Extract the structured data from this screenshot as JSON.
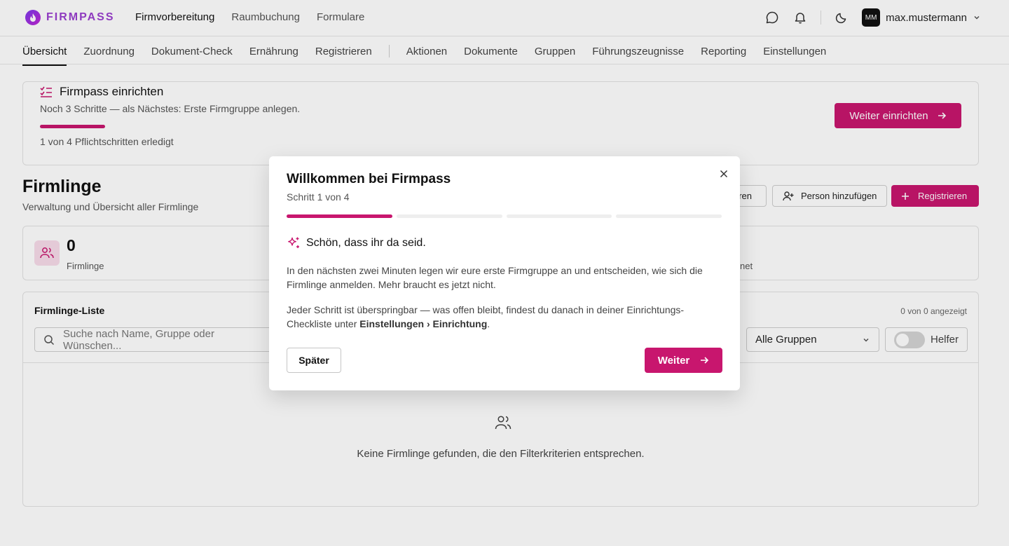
{
  "brand": {
    "name": "FIRMPASS",
    "accent": "#c8166e"
  },
  "topnav": {
    "items": [
      "Firmvorbereitung",
      "Raumbuchung",
      "Formulare"
    ],
    "user": {
      "initials": "MM",
      "name": "max.mustermann"
    }
  },
  "subnav": {
    "group1": [
      "Übersicht",
      "Zuordnung",
      "Dokument-Check",
      "Ernährung",
      "Registrieren"
    ],
    "group2": [
      "Aktionen",
      "Dokumente",
      "Gruppen",
      "Führungszeugnisse",
      "Reporting",
      "Einstellungen"
    ]
  },
  "setup": {
    "title": "Firmpass einrichten",
    "subtitle": "Noch 3 Schritte — als Nächstes: Erste Firmgruppe anlegen.",
    "count": "1 von 4 Pflichtschritten erledigt",
    "progress": 0.25,
    "button": "Weiter einrichten"
  },
  "section": {
    "title": "Firmlinge",
    "subtitle": "Verwaltung und Übersicht aller Firmlinge",
    "btn_partial": "eren",
    "btn_add": "Person hinzufügen",
    "btn_register": "Registrieren"
  },
  "stats": {
    "count": "0",
    "label": "Firmlinge",
    "right_label_partial": "net"
  },
  "list": {
    "title": "Firmlinge-Liste",
    "count": "0 von 0 angezeigt",
    "search_placeholder": "Suche nach Name, Gruppe oder Wünschen...",
    "group_select": "Alle Gruppen",
    "toggle_label": "Helfer",
    "empty": "Keine Firmlinge gefunden, die den Filterkriterien entsprechen."
  },
  "modal": {
    "title": "Willkommen bei Firmpass",
    "step": "Schritt 1 von 4",
    "steps_total": 4,
    "steps_done": 1,
    "heading": "Schön, dass ihr da seid.",
    "p1": "In den nächsten zwei Minuten legen wir eure erste Firmgruppe an und entscheiden, wie sich die Firmlinge anmelden. Mehr braucht es jetzt nicht.",
    "p2_a": "Jeder Schritt ist überspringbar — was offen bleibt, findest du danach in deiner Einrichtungs-Checkliste unter ",
    "p2_b": "Einstellungen › Einrichtung",
    "p2_c": ".",
    "later": "Später",
    "next": "Weiter"
  }
}
